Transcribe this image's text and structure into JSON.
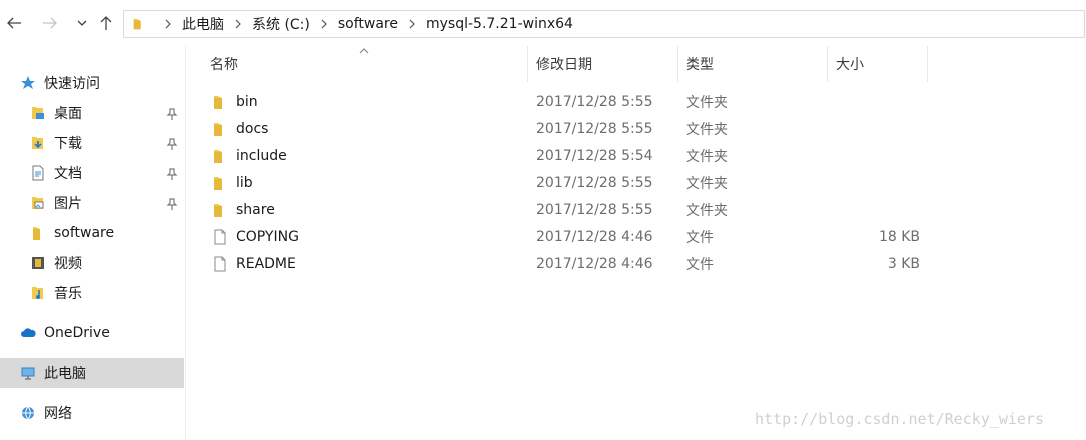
{
  "address": {
    "crumbs": [
      "此电脑",
      "系统 (C:)",
      "software",
      "mysql-5.7.21-winx64"
    ]
  },
  "sidebar": {
    "items": [
      {
        "label": "快速访问",
        "icon": "star-icon"
      },
      {
        "label": "桌面",
        "icon": "desktop-icon",
        "pinned": true
      },
      {
        "label": "下载",
        "icon": "download-icon",
        "pinned": true
      },
      {
        "label": "文档",
        "icon": "document-icon",
        "pinned": true
      },
      {
        "label": "图片",
        "icon": "picture-icon",
        "pinned": true
      },
      {
        "label": "software",
        "icon": "folder-icon"
      },
      {
        "label": "视频",
        "icon": "video-icon"
      },
      {
        "label": "音乐",
        "icon": "music-icon"
      },
      {
        "label": "OneDrive",
        "icon": "cloud-icon"
      },
      {
        "label": "此电脑",
        "icon": "computer-icon",
        "selected": true
      },
      {
        "label": "网络",
        "icon": "network-icon"
      }
    ]
  },
  "columns": {
    "name": "名称",
    "date": "修改日期",
    "type": "类型",
    "size": "大小"
  },
  "files": [
    {
      "name": "bin",
      "date": "2017/12/28 5:55",
      "type": "文件夹",
      "size": "",
      "kind": "folder"
    },
    {
      "name": "docs",
      "date": "2017/12/28 5:55",
      "type": "文件夹",
      "size": "",
      "kind": "folder"
    },
    {
      "name": "include",
      "date": "2017/12/28 5:54",
      "type": "文件夹",
      "size": "",
      "kind": "folder"
    },
    {
      "name": "lib",
      "date": "2017/12/28 5:55",
      "type": "文件夹",
      "size": "",
      "kind": "folder"
    },
    {
      "name": "share",
      "date": "2017/12/28 5:55",
      "type": "文件夹",
      "size": "",
      "kind": "folder"
    },
    {
      "name": "COPYING",
      "date": "2017/12/28 4:46",
      "type": "文件",
      "size": "18 KB",
      "kind": "file"
    },
    {
      "name": "README",
      "date": "2017/12/28 4:46",
      "type": "文件",
      "size": "3 KB",
      "kind": "file"
    }
  ],
  "watermark": "http://blog.csdn.net/Recky_wiers",
  "colors": {
    "folder": "#f2c94c",
    "selected": "#d9d9d9",
    "accent": "#1a73c8"
  }
}
